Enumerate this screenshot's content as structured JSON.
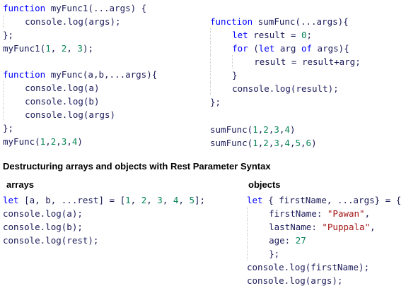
{
  "blocks": {
    "myfunc1": [
      [
        {
          "t": "function",
          "c": "kw"
        },
        {
          "t": " myFunc1(...args) {",
          "c": "plain"
        }
      ],
      [
        {
          "t": "    ",
          "c": "ind"
        },
        {
          "t": "console.log(args);",
          "c": "plain"
        }
      ],
      [
        {
          "t": "};",
          "c": "plain"
        }
      ],
      [
        {
          "t": "myFunc1(",
          "c": "plain"
        },
        {
          "t": "1",
          "c": "num"
        },
        {
          "t": ", ",
          "c": "plain"
        },
        {
          "t": "2",
          "c": "num"
        },
        {
          "t": ", ",
          "c": "plain"
        },
        {
          "t": "3",
          "c": "num"
        },
        {
          "t": ");",
          "c": "plain"
        }
      ]
    ],
    "myfunc": [
      [
        {
          "t": "function",
          "c": "kw"
        },
        {
          "t": " myFunc(a,b,...args){",
          "c": "plain"
        }
      ],
      [
        {
          "t": "    ",
          "c": "ind"
        },
        {
          "t": "console.log(a)",
          "c": "plain"
        }
      ],
      [
        {
          "t": "    ",
          "c": "ind"
        },
        {
          "t": "console.log(b)",
          "c": "plain"
        }
      ],
      [
        {
          "t": "    ",
          "c": "ind"
        },
        {
          "t": "console.log(args)",
          "c": "plain"
        }
      ],
      [
        {
          "t": "};",
          "c": "plain"
        }
      ],
      [
        {
          "t": "myFunc(",
          "c": "plain"
        },
        {
          "t": "1",
          "c": "num"
        },
        {
          "t": ",",
          "c": "plain"
        },
        {
          "t": "2",
          "c": "num"
        },
        {
          "t": ",",
          "c": "plain"
        },
        {
          "t": "3",
          "c": "num"
        },
        {
          "t": ",",
          "c": "plain"
        },
        {
          "t": "4",
          "c": "num"
        },
        {
          "t": ")",
          "c": "plain"
        }
      ]
    ],
    "sumfunc": [
      [
        {
          "t": "function",
          "c": "kw"
        },
        {
          "t": " sumFunc(...args){",
          "c": "plain"
        }
      ],
      [
        {
          "t": "    ",
          "c": "ind"
        },
        {
          "t": "let",
          "c": "kw"
        },
        {
          "t": " result = ",
          "c": "plain"
        },
        {
          "t": "0",
          "c": "num"
        },
        {
          "t": ";",
          "c": "plain"
        }
      ],
      [
        {
          "t": "    ",
          "c": "ind"
        },
        {
          "t": "for",
          "c": "kw"
        },
        {
          "t": " (",
          "c": "plain"
        },
        {
          "t": "let",
          "c": "kw"
        },
        {
          "t": " arg ",
          "c": "plain"
        },
        {
          "t": "of",
          "c": "kw"
        },
        {
          "t": " args){",
          "c": "plain"
        }
      ],
      [
        {
          "t": "    ",
          "c": "ind"
        },
        {
          "t": "    ",
          "c": "ind"
        },
        {
          "t": "result = result+arg;",
          "c": "plain"
        }
      ],
      [
        {
          "t": "    ",
          "c": "ind"
        },
        {
          "t": "}",
          "c": "plain"
        }
      ],
      [
        {
          "t": "    ",
          "c": "ind"
        },
        {
          "t": "console.log(result);",
          "c": "plain"
        }
      ],
      [
        {
          "t": "};",
          "c": "plain"
        }
      ]
    ],
    "sumcalls": [
      [
        {
          "t": "sumFunc(",
          "c": "plain"
        },
        {
          "t": "1",
          "c": "num"
        },
        {
          "t": ",",
          "c": "plain"
        },
        {
          "t": "2",
          "c": "num"
        },
        {
          "t": ",",
          "c": "plain"
        },
        {
          "t": "3",
          "c": "num"
        },
        {
          "t": ",",
          "c": "plain"
        },
        {
          "t": "4",
          "c": "num"
        },
        {
          "t": ")",
          "c": "plain"
        }
      ],
      [
        {
          "t": "sumFunc(",
          "c": "plain"
        },
        {
          "t": "1",
          "c": "num"
        },
        {
          "t": ",",
          "c": "plain"
        },
        {
          "t": "2",
          "c": "num"
        },
        {
          "t": ",",
          "c": "plain"
        },
        {
          "t": "3",
          "c": "num"
        },
        {
          "t": ",",
          "c": "plain"
        },
        {
          "t": "4",
          "c": "num"
        },
        {
          "t": ",",
          "c": "plain"
        },
        {
          "t": "5",
          "c": "num"
        },
        {
          "t": ",",
          "c": "plain"
        },
        {
          "t": "6",
          "c": "num"
        },
        {
          "t": ")",
          "c": "plain"
        }
      ]
    ],
    "arrays": [
      [
        {
          "t": "let",
          "c": "kw"
        },
        {
          "t": " [a, b, ...rest] = [",
          "c": "plain"
        },
        {
          "t": "1",
          "c": "num"
        },
        {
          "t": ", ",
          "c": "plain"
        },
        {
          "t": "2",
          "c": "num"
        },
        {
          "t": ", ",
          "c": "plain"
        },
        {
          "t": "3",
          "c": "num"
        },
        {
          "t": ", ",
          "c": "plain"
        },
        {
          "t": "4",
          "c": "num"
        },
        {
          "t": ", ",
          "c": "plain"
        },
        {
          "t": "5",
          "c": "num"
        },
        {
          "t": "];",
          "c": "plain"
        }
      ],
      [
        {
          "t": "console.log(a);",
          "c": "plain"
        }
      ],
      [
        {
          "t": "console.log(b);",
          "c": "plain"
        }
      ],
      [
        {
          "t": "console.log(rest);",
          "c": "plain"
        }
      ]
    ],
    "objects": [
      [
        {
          "t": "let",
          "c": "kw"
        },
        {
          "t": " { firstName, ...args} = {",
          "c": "plain"
        }
      ],
      [
        {
          "t": "    ",
          "c": "ind"
        },
        {
          "t": "firstName: ",
          "c": "plain"
        },
        {
          "t": "\"Pawan\"",
          "c": "str"
        },
        {
          "t": ",",
          "c": "plain"
        }
      ],
      [
        {
          "t": "    ",
          "c": "ind"
        },
        {
          "t": "lastName: ",
          "c": "plain"
        },
        {
          "t": "\"Puppala\"",
          "c": "str"
        },
        {
          "t": ",",
          "c": "plain"
        }
      ],
      [
        {
          "t": "    ",
          "c": "ind"
        },
        {
          "t": "age: ",
          "c": "plain"
        },
        {
          "t": "27",
          "c": "num"
        }
      ],
      [
        {
          "t": "    ",
          "c": "ind"
        },
        {
          "t": "};",
          "c": "plain"
        }
      ],
      [
        {
          "t": "console.log(firstName);",
          "c": "plain"
        }
      ],
      [
        {
          "t": "console.log(args);",
          "c": "plain"
        }
      ]
    ]
  },
  "headings": {
    "main": "Destructuring arrays and objects with Rest Parameter Syntax",
    "arrays": "arrays",
    "objects": "objects"
  },
  "colors": {
    "keyword": "#0000ff",
    "number": "#098658",
    "string": "#a31515",
    "text": "#1b1b5a"
  }
}
